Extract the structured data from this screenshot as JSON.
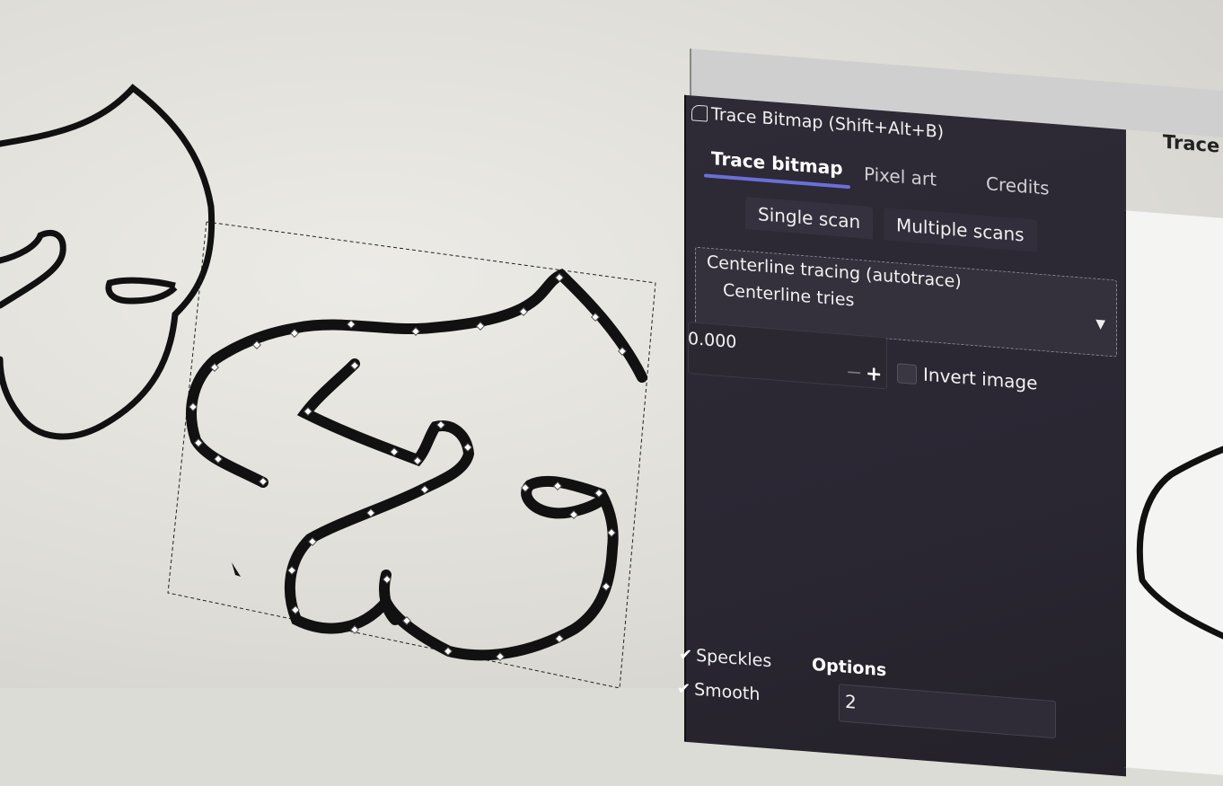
{
  "dialog": {
    "title": "Trace Bitmap (Shift+Alt+B)",
    "right_title": "Trace",
    "tabs": [
      {
        "label": "Trace bitmap",
        "active": true
      },
      {
        "label": "Pixel art",
        "active": false
      },
      {
        "label": "Credits",
        "active": false
      }
    ],
    "subtabs": [
      {
        "label": "Single scan",
        "active": true
      },
      {
        "label": "Multiple scans",
        "active": false
      }
    ],
    "mode_select": {
      "value": "Centerline tracing (autotrace)",
      "option_label": "Centerline tries"
    },
    "tries_value": "0.000",
    "invert_image": {
      "label": "Invert image",
      "checked": false
    },
    "speckles": {
      "label": "Speckles",
      "checked": true
    },
    "smooth": {
      "label": "Smooth",
      "checked": true
    },
    "options_label": "Options",
    "speckles_value": "2"
  },
  "colors": {
    "panel_bg": "#2c2934",
    "accent": "#6b6fd8",
    "canvas_bg": "#e4e3de",
    "stroke": "#111111"
  },
  "icons": {
    "dialog_icon": "trace-bitmap-icon",
    "dropdown": "chevron-down-icon",
    "minus": "minus-icon",
    "plus": "plus-icon",
    "check": "checkmark-icon"
  }
}
